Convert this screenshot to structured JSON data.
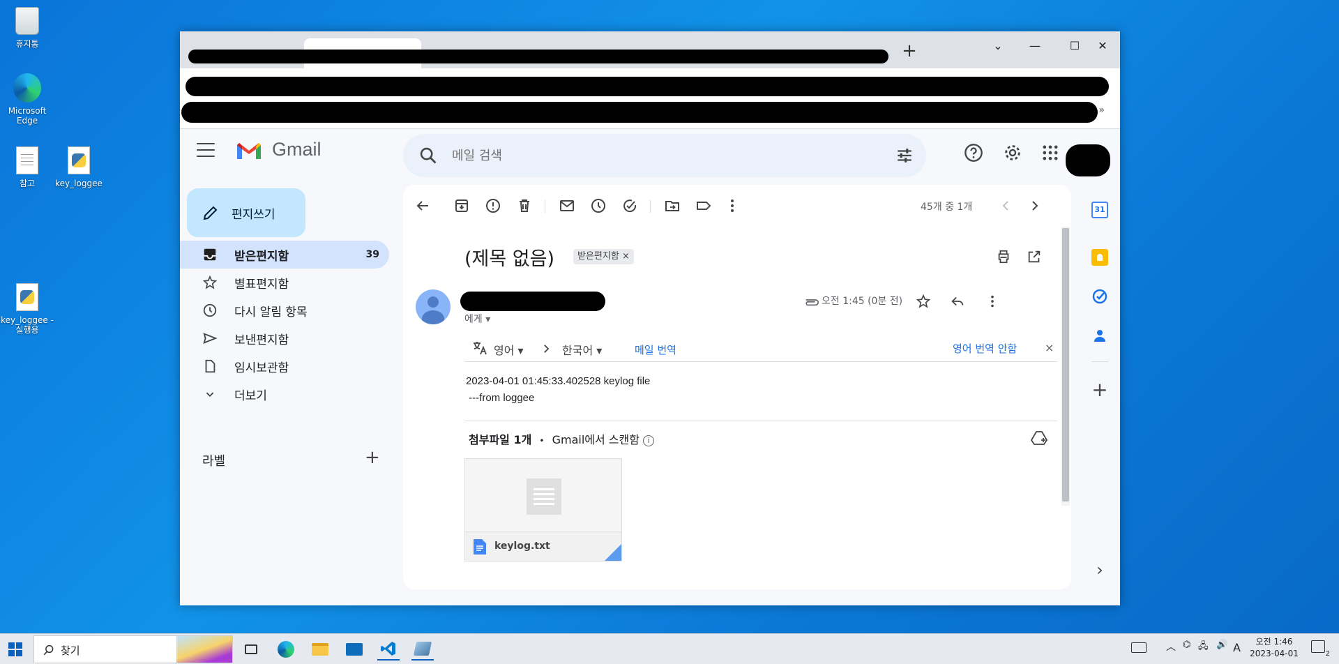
{
  "desktop": {
    "icons": [
      {
        "label": "휴지통"
      },
      {
        "label": "Microsoft Edge"
      },
      {
        "label": "참고"
      },
      {
        "label": "key_loggee"
      },
      {
        "label": "key_loggee - 실행용"
      }
    ]
  },
  "browser": {
    "new_tab_label": "+",
    "controls": {
      "tabsearch": "⌄",
      "minimize": "—",
      "maximize": "☐",
      "close": "✕"
    },
    "bookmarks_overflow": "»"
  },
  "gmail": {
    "app_name": "Gmail",
    "search": {
      "placeholder": "메일 검색"
    },
    "compose_label": "편지쓰기",
    "nav": [
      {
        "label": "받은편지함",
        "count": "39",
        "icon": "inbox-icon"
      },
      {
        "label": "별표편지함",
        "icon": "star-icon"
      },
      {
        "label": "다시 알림 항목",
        "icon": "clock-icon"
      },
      {
        "label": "보낸편지함",
        "icon": "send-icon"
      },
      {
        "label": "임시보관함",
        "icon": "draft-icon"
      },
      {
        "label": "더보기",
        "icon": "chevron-down-icon"
      }
    ],
    "labels_header": "라벨",
    "labels_add": "+",
    "toolbar": {
      "pager": "45개 중 1개"
    },
    "message": {
      "subject": "(제목 없음)",
      "label_chip": "받은편지함",
      "label_chip_remove": "×",
      "to": "에게",
      "time": "오전 1:45 (0분 전)",
      "translate": {
        "from_lang": "영어",
        "to_lang": "한국어",
        "translate_link": "메일 번역",
        "no_translate_link": "영어 번역 안함",
        "close": "×"
      },
      "body_line1": "2023-04-01 01:45:33.402528 keylog file",
      "body_line2": " ---from loggee",
      "attachments_header": "첨부파일 1개",
      "attachments_dot": "•",
      "attachments_scan": "Gmail에서 스캔함",
      "attachment": {
        "filename": "keylog.txt"
      }
    },
    "side_panel": {
      "calendar_day": "31",
      "add": "+",
      "expand": "›"
    }
  },
  "taskbar": {
    "search_placeholder": "찾기",
    "ime": "A",
    "clock_time": "오전 1:46",
    "clock_date": "2023-04-01",
    "notification_count": "2"
  },
  "colors": {
    "compose_bg": "#c2e7ff",
    "active_nav_bg": "#d3e3fd",
    "link": "#1a73e8",
    "gmail_bg": "#f6f8fc"
  }
}
